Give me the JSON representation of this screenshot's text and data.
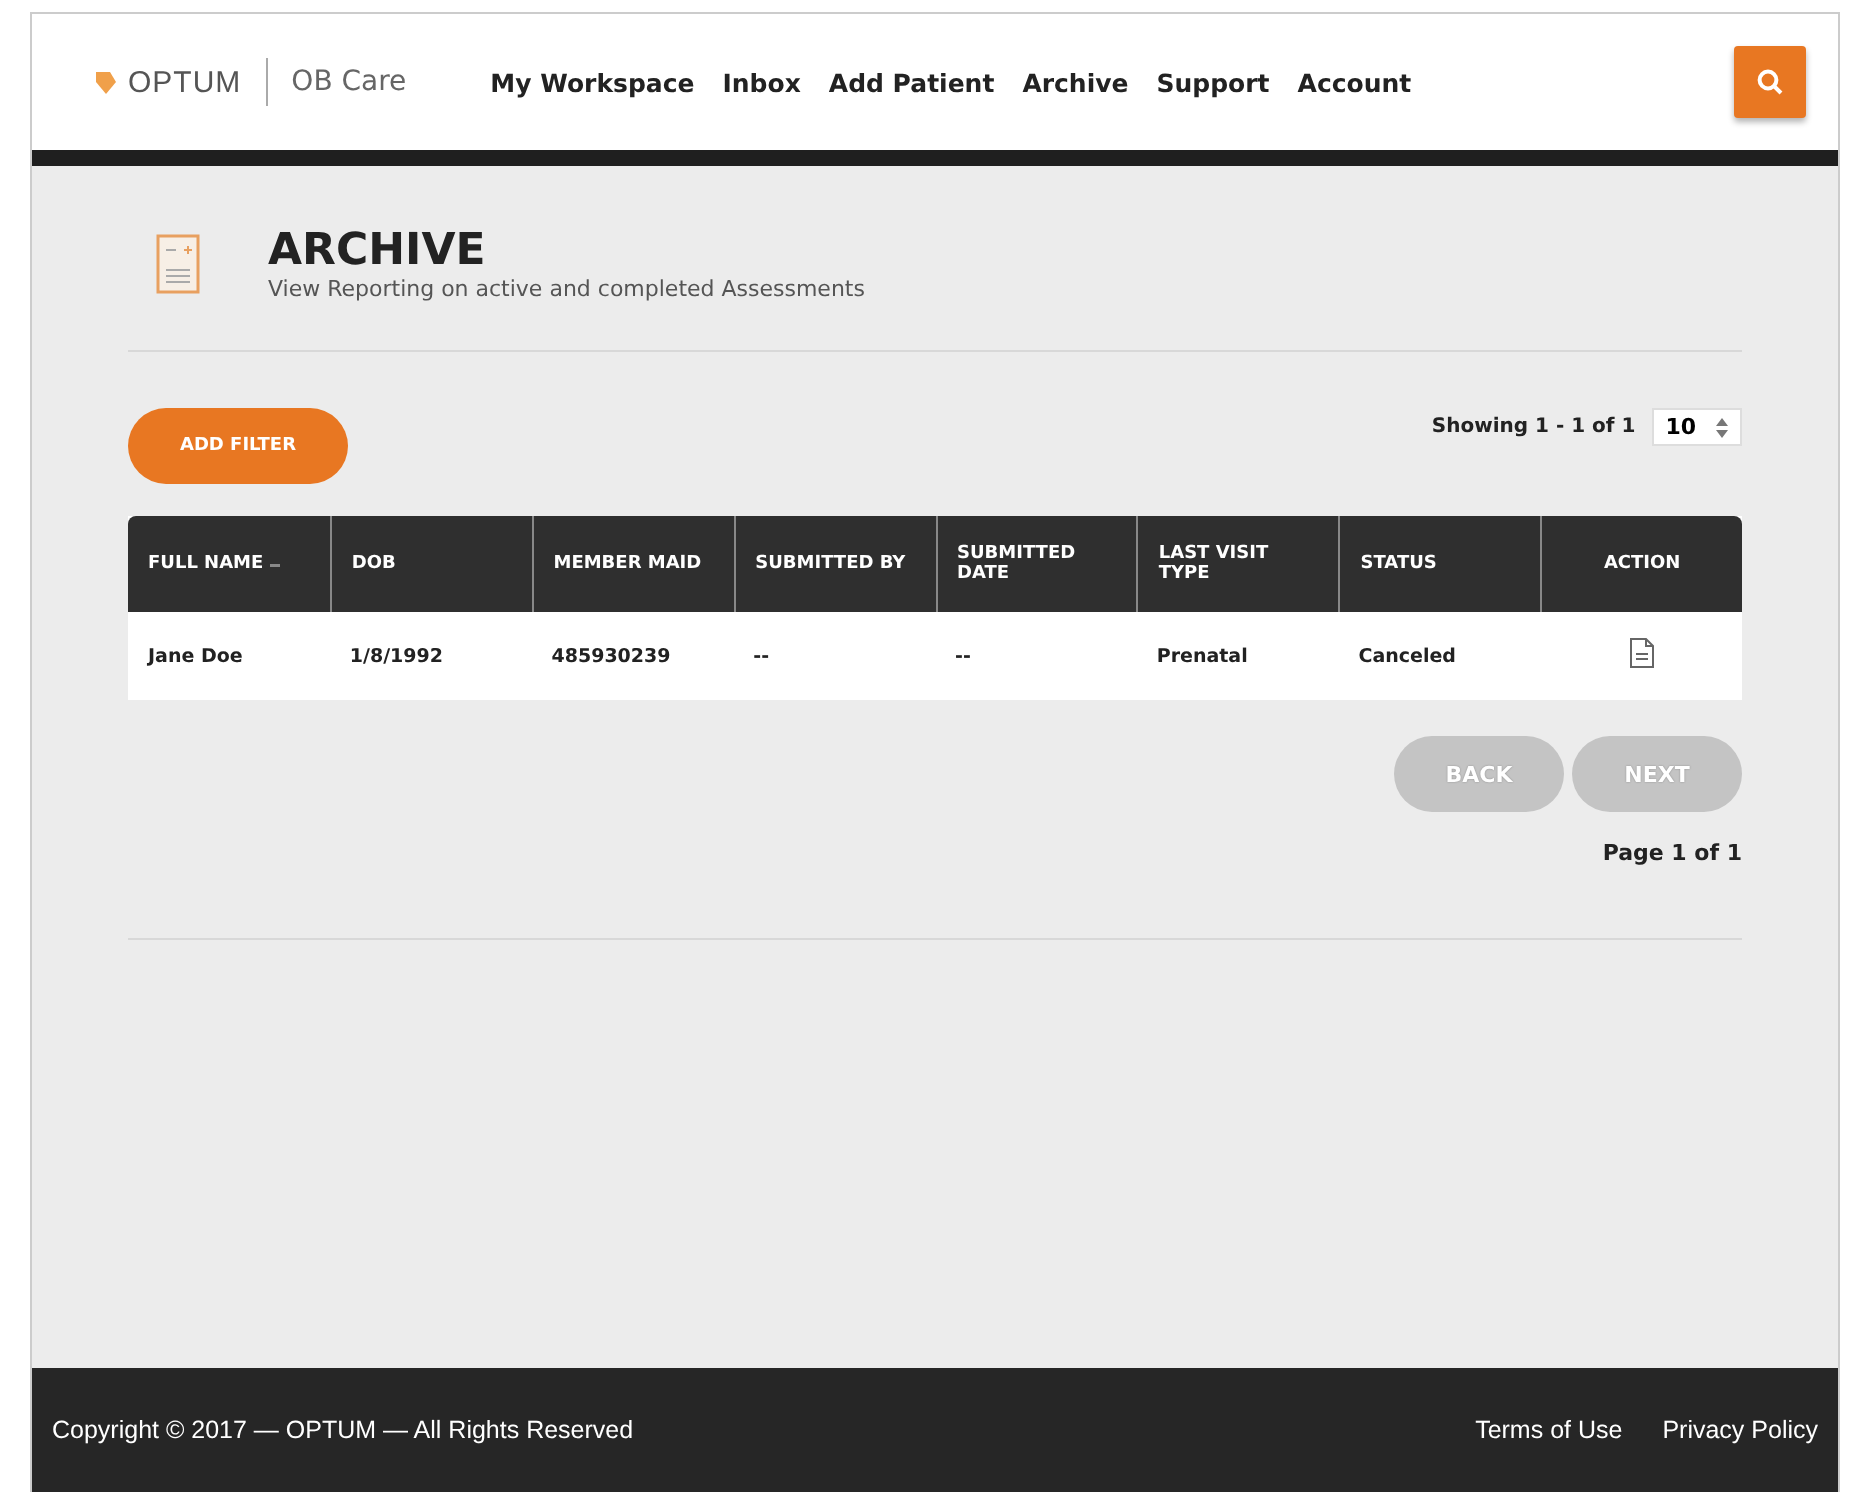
{
  "header": {
    "brand": "OPTUM",
    "product": "OB Care",
    "nav": [
      {
        "label": "My Workspace"
      },
      {
        "label": "Inbox"
      },
      {
        "label": "Add Patient"
      },
      {
        "label": "Archive"
      },
      {
        "label": "Support"
      },
      {
        "label": "Account"
      }
    ]
  },
  "page": {
    "title": "ARCHIVE",
    "subtitle": "View Reporting on active and completed Assessments"
  },
  "toolbar": {
    "add_filter": "ADD FILTER",
    "showing": "Showing 1 - 1 of 1",
    "page_size": "10"
  },
  "table": {
    "columns": [
      {
        "label": "FULL NAME",
        "sorted": true
      },
      {
        "label": "DOB",
        "sorted": false
      },
      {
        "label": "MEMBER MAID",
        "sorted": false
      },
      {
        "label": "SUBMITTED BY",
        "sorted": false
      },
      {
        "label": "SUBMITTED DATE",
        "sorted": false
      },
      {
        "label": "LAST VISIT TYPE",
        "sorted": false
      },
      {
        "label": "STATUS",
        "sorted": false
      },
      {
        "label": "ACTION",
        "sorted": false
      }
    ],
    "rows": [
      {
        "cells": [
          "Jane Doe",
          "1/8/1992",
          "485930239",
          "--",
          "--",
          "Prenatal",
          "Canceled"
        ]
      }
    ]
  },
  "pager": {
    "back": {
      "label": "BACK",
      "disabled": true
    },
    "next": {
      "label": "NEXT",
      "disabled": true
    },
    "page": "Page 1 of 1"
  },
  "footer": {
    "copyright": "Copyright © 2017 — OPTUM — All Rights Reserved",
    "links": [
      "Terms of Use",
      "Privacy Policy"
    ]
  }
}
